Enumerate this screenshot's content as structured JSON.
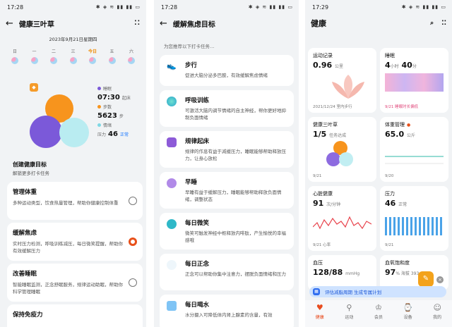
{
  "phone1": {
    "time": "17:28",
    "status_icons": "✱ ◈ ≋ ▮▮ ▮▮ ▭",
    "title": "健康三叶草",
    "date": "2023年9月21日星期四",
    "weekdays": [
      "日",
      "一",
      "二",
      "三",
      "今日",
      "五",
      "六"
    ],
    "stats": {
      "sleep_label": "睡眠",
      "sleep_value": "07:30",
      "sleep_sub": "起床",
      "steps_label": "步数",
      "steps_value": "5623",
      "steps_sub": "步",
      "mood_label": "情绪",
      "stress_label": "压力",
      "stress_value": "46",
      "stress_sub": "正常"
    },
    "section_title": "创建健康目标",
    "section_sub": "解锁更多打卡任务",
    "goals": [
      {
        "title": "管理体重",
        "desc": "多种运动类型，饮食热量管理，帮助你健康控制体重"
      },
      {
        "title": "缓解焦虑",
        "desc": "实时压力检测，呼吸训练减压，每日微笑提醒，帮助你有效缓解压力"
      },
      {
        "title": "改善睡眠",
        "desc": "智能睡眠监测，正念舒眠服务，规律运动助眠，帮助你科学管理睡眠"
      },
      {
        "title": "保持免疫力",
        "desc": ""
      }
    ]
  },
  "phone2": {
    "time": "17:28",
    "status_icons": "✱ ◈ ≋ ▮▮ ▮▮ ▭",
    "title": "缓解焦虑目标",
    "subtitle": "为您推荐以下打卡任务…",
    "tasks": [
      {
        "title": "步行",
        "desc": "促进大脑分泌多巴胺，有效缓解焦虑情绪"
      },
      {
        "title": "呼吸训练",
        "desc": "可激活大脑内调节情绪的自主神经，帮你更好地抑制负面情绪"
      },
      {
        "title": "规律起床",
        "desc": "规律的作息有益于减缓压力，睡眠能够帮助释放压力，让身心放松"
      },
      {
        "title": "早睡",
        "desc": "早睡有益于缓解压力，睡眠能够帮助释放负面情绪，调整状态"
      },
      {
        "title": "每日微笑",
        "desc": "微笑可触发神经中枢释放内啡肽，产生愉悦的幸福感哦"
      },
      {
        "title": "每日正念",
        "desc": "正念可以帮助你集中注意力，摆脱负面情绪和压力"
      },
      {
        "title": "每日喝水",
        "desc": "水分摄入可降低体内肾上腺素的含量，有效"
      }
    ]
  },
  "phone3": {
    "time": "17:29",
    "status_icons": "✱ ◈ ≋ ▮▮ ▮▮ ▭",
    "title": "健康",
    "tiles": {
      "exercise": {
        "label": "运动记录",
        "value": "0.96",
        "unit": "公里",
        "date": "2021/12/24 室内步行"
      },
      "sleep": {
        "label": "睡眠",
        "value": "4",
        "unit1": "小时",
        "value2": "40",
        "unit2": "分",
        "date": "9/21 睡眠时长偏低"
      },
      "clover": {
        "label": "健康三叶草",
        "value": "1/5",
        "unit": "任务达成",
        "date": "9/21"
      },
      "weight": {
        "label": "体重管理",
        "value": "65.0",
        "unit": "公斤",
        "date": "9/20"
      },
      "heart": {
        "label": "心脏健康",
        "value": "91",
        "unit": "次/分钟",
        "date": "9/21 心率"
      },
      "stress": {
        "label": "压力",
        "value": "46",
        "unit": "正常",
        "date": "9/21"
      },
      "bp": {
        "label": "血压",
        "value": "128/88",
        "unit": "mmHg"
      },
      "spo2": {
        "label": "血氧饱和度",
        "value": "97",
        "unit": "% 海拔 393 m"
      }
    },
    "banner": "评估减脂周期 生成专属计划",
    "nav": [
      "健康",
      "运动",
      "会员",
      "设备",
      "我的"
    ]
  },
  "colors": {
    "accent": "#f7941d",
    "purple": "#7b59d9",
    "cyan": "#b9ecf1",
    "active": "#e84c1e"
  }
}
